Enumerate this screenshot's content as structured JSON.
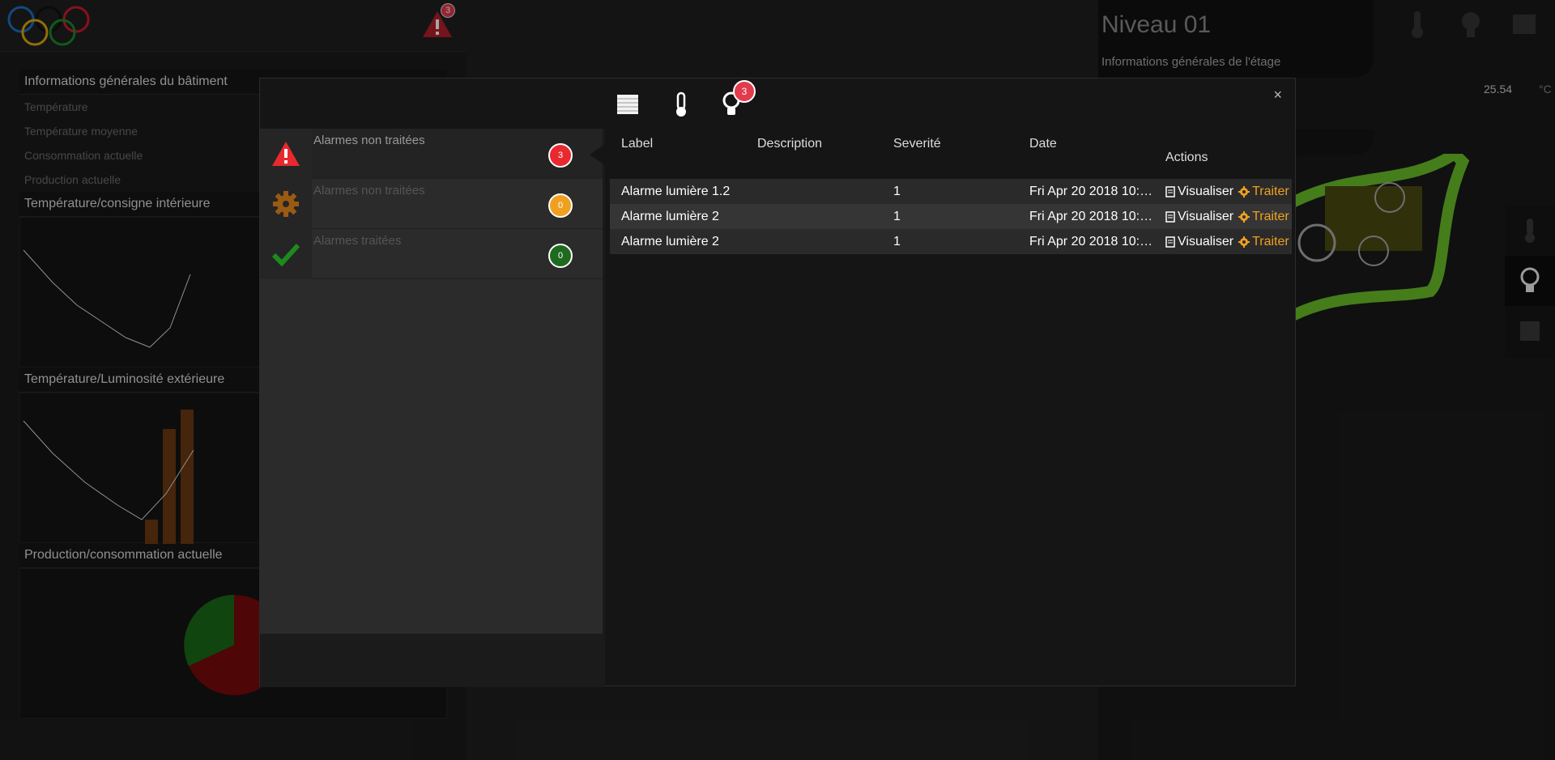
{
  "topbar": {
    "alarm_count": "3"
  },
  "building": {
    "title": "Informations générales du bâtiment",
    "rows": [
      "Température",
      "Température moyenne",
      "Consommation actuelle",
      "Production actuelle"
    ],
    "chart1_title": "Température/consigne intérieure",
    "chart2_title": "Température/Luminosité extérieure",
    "chart3_title": "Production/consommation actuelle"
  },
  "floor": {
    "title": "Niveau 01",
    "subtitle": "Informations générales de l'étage",
    "temp_value": "25.54",
    "temp_unit": "°C"
  },
  "modal": {
    "tab_badge": "3",
    "close": "×",
    "alarm_groups": [
      {
        "label": "Alarmes non traitées",
        "count": "3",
        "color": "#e8292f"
      },
      {
        "label": "Alarmes non traitées",
        "count": "0",
        "color": "#f0a020"
      },
      {
        "label": "Alarmes traitées",
        "count": "0",
        "color": "#1e8a1e"
      }
    ],
    "table": {
      "headers": [
        "Label",
        "Description",
        "Severité",
        "Date",
        "Actions"
      ],
      "rows": [
        {
          "label": "Alarme lumière 1.2",
          "description": "",
          "severity": "1",
          "date": "Fri Apr 20 2018 10:…"
        },
        {
          "label": "Alarme lumière 2",
          "description": "",
          "severity": "1",
          "date": "Fri Apr 20 2018 10:…"
        },
        {
          "label": "Alarme lumière 2",
          "description": "",
          "severity": "1",
          "date": "Fri Apr 20 2018 10:…"
        }
      ],
      "action_view": "Visualiser",
      "action_process": "Traiter"
    }
  },
  "colors": {
    "accent_orange": "#f0a020",
    "danger_red": "#e8292f",
    "ok_green": "#1e8a1e",
    "map_green": "#6ac02a"
  }
}
